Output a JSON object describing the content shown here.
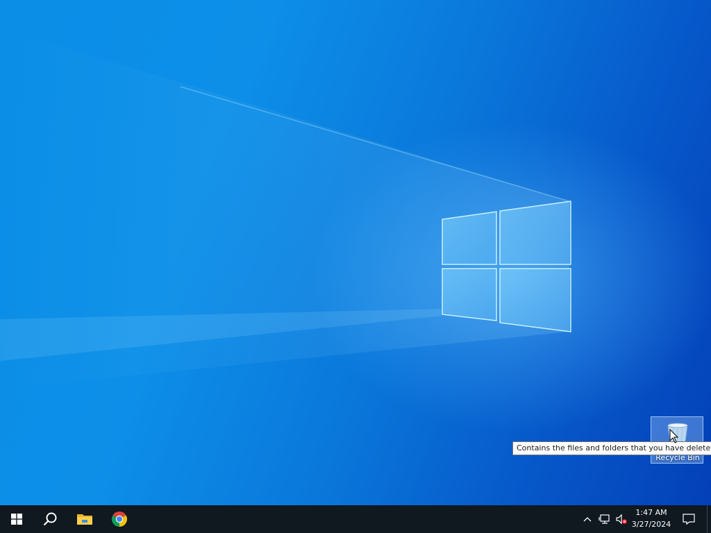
{
  "desktop": {
    "icons": [
      {
        "label": "Recycle Bin",
        "icon": "recycle-bin-icon",
        "tooltip": "Contains the files and folders that you have deleted."
      }
    ]
  },
  "taskbar": {
    "start_icon": "windows-logo-icon",
    "search_icon": "search-icon",
    "pinned": [
      {
        "name": "File Explorer",
        "icon": "file-explorer-icon"
      },
      {
        "name": "Google Chrome",
        "icon": "chrome-icon"
      }
    ],
    "tray": {
      "overflow_icon": "chevron-up-icon",
      "network_icon": "network-icon",
      "volume_icon": "volume-muted-icon"
    },
    "clock": {
      "time": "1:47 AM",
      "date": "3/27/2024"
    },
    "notifications_icon": "action-center-icon"
  },
  "colors": {
    "taskbar_bg": "#101820",
    "desktop_accent": "#0a8ee6",
    "tooltip_bg": "#ffffff"
  }
}
